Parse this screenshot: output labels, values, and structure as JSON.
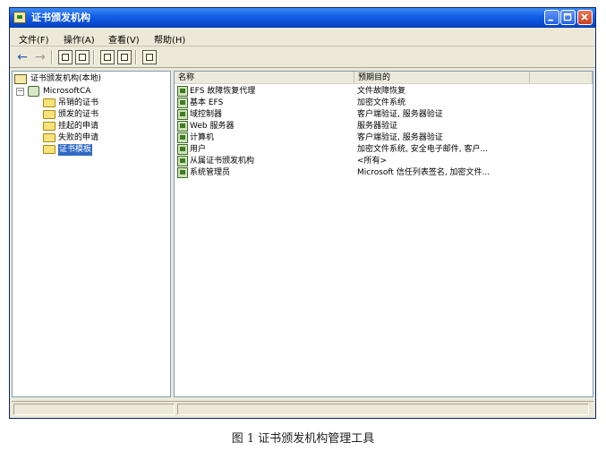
{
  "window": {
    "title": "证书颁发机构"
  },
  "menu": [
    "文件(F)",
    "操作(A)",
    "查看(V)",
    "帮助(H)"
  ],
  "toolbar": {
    "back_icon": "back-arrow-icon",
    "forward_icon": "forward-arrow-icon"
  },
  "tree": {
    "root": "证书颁发机构(本地)",
    "ca": "MicrosoftCA",
    "children": [
      "吊销的证书",
      "颁发的证书",
      "挂起的申请",
      "失败的申请",
      "证书模板"
    ],
    "selected_index": 4
  },
  "list": {
    "columns": [
      "名称",
      "预期目的"
    ],
    "rows": [
      {
        "name": "EFS 故障恢复代理",
        "purpose": "文件故障恢复"
      },
      {
        "name": "基本 EFS",
        "purpose": "加密文件系统"
      },
      {
        "name": "域控制器",
        "purpose": "客户端验证, 服务器验证"
      },
      {
        "name": "Web 服务器",
        "purpose": "服务器验证"
      },
      {
        "name": "计算机",
        "purpose": "客户端验证, 服务器验证"
      },
      {
        "name": "用户",
        "purpose": "加密文件系统, 安全电子邮件, 客户..."
      },
      {
        "name": "从属证书颁发机构",
        "purpose": "<所有>"
      },
      {
        "name": "系统管理员",
        "purpose": "Microsoft 信任列表签名, 加密文件..."
      }
    ]
  },
  "caption": "图 1 证书颁发机构管理工具"
}
